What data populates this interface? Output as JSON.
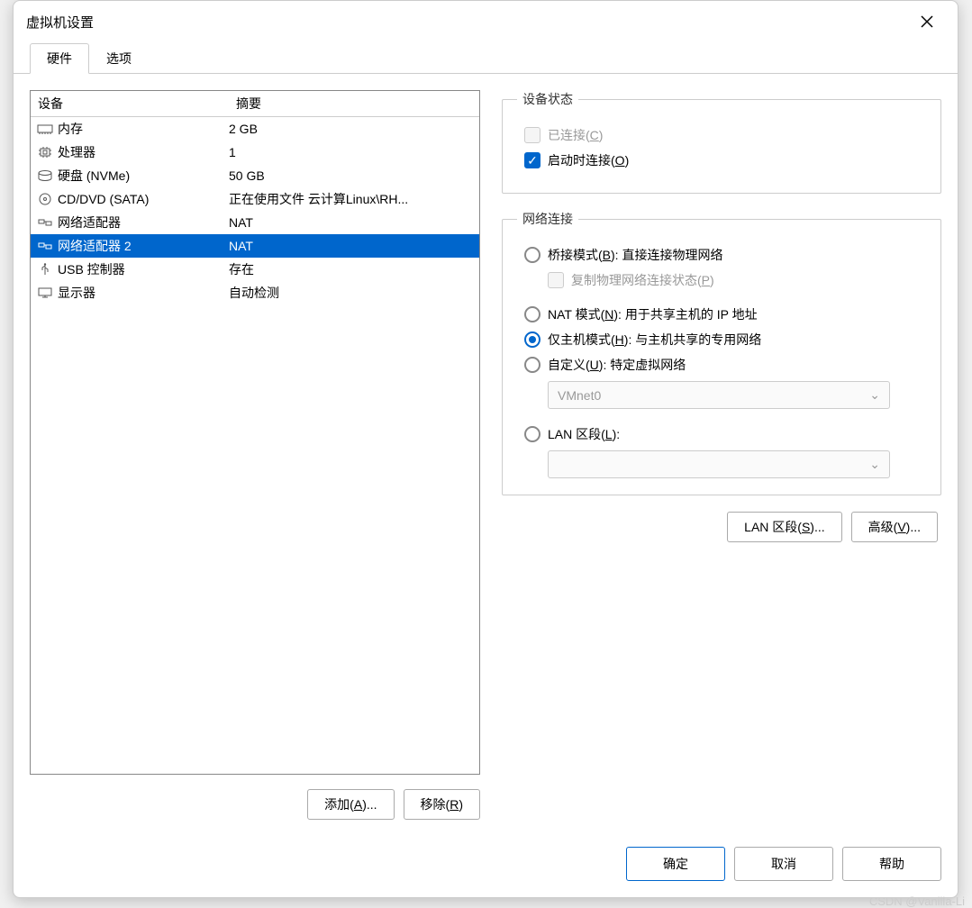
{
  "title": "虚拟机设置",
  "tabs": {
    "hardware": "硬件",
    "options": "选项"
  },
  "list": {
    "headers": {
      "device": "设备",
      "summary": "摘要"
    },
    "rows": [
      {
        "icon": "memory",
        "name": "内存",
        "summary": "2 GB"
      },
      {
        "icon": "cpu",
        "name": "处理器",
        "summary": "1"
      },
      {
        "icon": "disk",
        "name": "硬盘 (NVMe)",
        "summary": "50 GB"
      },
      {
        "icon": "cd",
        "name": "CD/DVD (SATA)",
        "summary": "正在使用文件 云计算Linux\\RH..."
      },
      {
        "icon": "net",
        "name": "网络适配器",
        "summary": "NAT"
      },
      {
        "icon": "net",
        "name": "网络适配器 2",
        "summary": "NAT",
        "selected": true
      },
      {
        "icon": "usb",
        "name": "USB 控制器",
        "summary": "存在"
      },
      {
        "icon": "display",
        "name": "显示器",
        "summary": "自动检测"
      }
    ]
  },
  "leftButtons": {
    "add": "添加(",
    "addKey": "A",
    "addSuffix": ")...",
    "remove": "移除(",
    "removeKey": "R",
    "removeSuffix": ")"
  },
  "deviceState": {
    "legend": "设备状态",
    "connected": "已连接(",
    "connectedKey": "C",
    "connectedSuffix": ")",
    "connectOnStart": "启动时连接(",
    "connectOnStartKey": "O",
    "connectOnStartSuffix": ")"
  },
  "netConn": {
    "legend": "网络连接",
    "bridge": "桥接模式(",
    "bridgeKey": "B",
    "bridgeSuffix": "): 直接连接物理网络",
    "replicate": "复制物理网络连接状态(",
    "replicateKey": "P",
    "replicateSuffix": ")",
    "nat": "NAT 模式(",
    "natKey": "N",
    "natSuffix": "): 用于共享主机的 IP 地址",
    "host": "仅主机模式(",
    "hostKey": "H",
    "hostSuffix": "): 与主机共享的专用网络",
    "custom": "自定义(",
    "customKey": "U",
    "customSuffix": "): 特定虚拟网络",
    "customSelect": "VMnet0",
    "lan": "LAN 区段(",
    "lanKey": "L",
    "lanSuffix": "):"
  },
  "rightButtons": {
    "lanseg": "LAN 区段(",
    "lansegKey": "S",
    "lansegSuffix": ")...",
    "advanced": "高级(",
    "advancedKey": "V",
    "advancedSuffix": ")..."
  },
  "footer": {
    "ok": "确定",
    "cancel": "取消",
    "help": "帮助"
  },
  "watermark": "CSDN @Vanilla-Li"
}
